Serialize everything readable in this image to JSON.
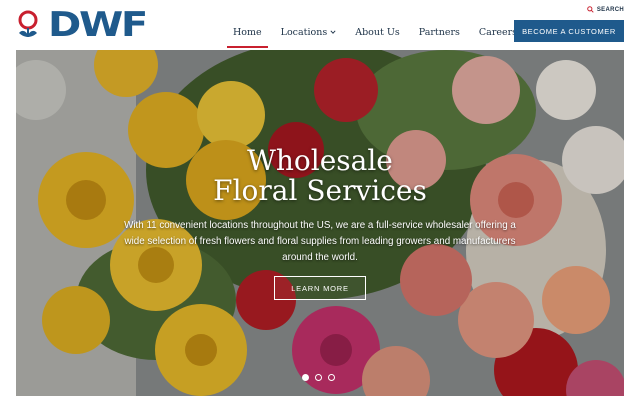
{
  "brand": {
    "logo_text": "DWF",
    "primary_color": "#1f5a8c",
    "accent_color": "#c8202f",
    "logo_icon": "rose-emblem-icon"
  },
  "header": {
    "search_label": "SEARCH",
    "search_icon": "search-icon",
    "nav": [
      {
        "label": "Home",
        "active": true
      },
      {
        "label": "Locations",
        "has_dropdown": true
      },
      {
        "label": "About Us"
      },
      {
        "label": "Partners"
      },
      {
        "label": "Careers"
      }
    ],
    "cta_label": "BECOME A CUSTOMER"
  },
  "hero": {
    "title_line1": "Wholesale",
    "title_line2": "Floral Services",
    "description": "With 11 convenient locations throughout the US, we are a full-service wholesaler offering a wide selection of fresh flowers and floral supplies from leading growers and manufacturers around the world.",
    "button_label": "LEARN MORE",
    "slides_total": 3,
    "slide_active": 1
  }
}
